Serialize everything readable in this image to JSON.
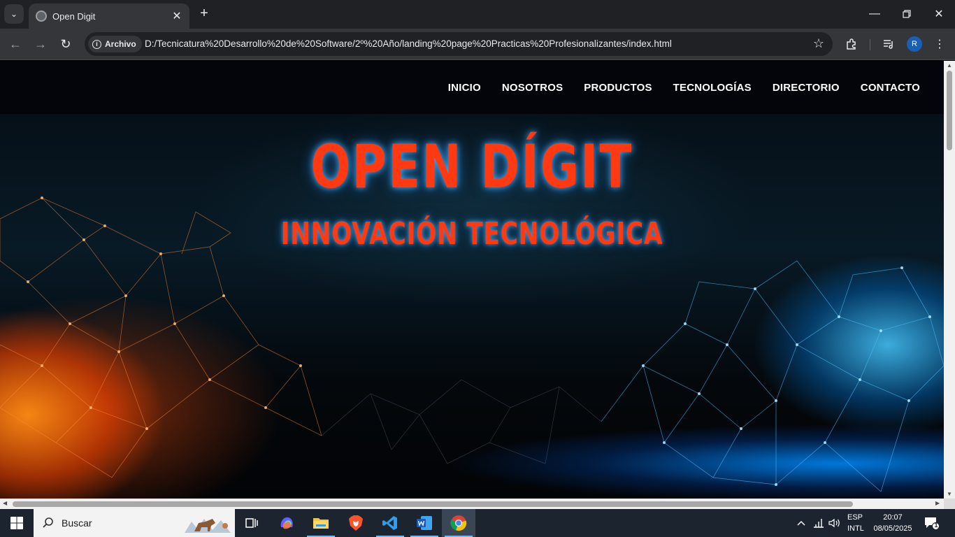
{
  "browser": {
    "tab_title": "Open Digit",
    "address_chip": "Archivo",
    "url": "D:/Tecnicatura%20Desarrollo%20de%20Software/2º%20Año/landing%20page%20Practicas%20Profesionalizantes/index.html",
    "profile_initial": "R"
  },
  "site": {
    "nav": [
      "INICIO",
      "NOSOTROS",
      "PRODUCTOS",
      "TECNOLOGÍAS",
      "DIRECTORIO",
      "CONTACTO"
    ],
    "hero_title": "OPEN DÍGIT",
    "hero_subtitle": "INNOVACIÓN TECNOLÓGICA",
    "accent_color": "#ff3a12",
    "glow_color": "#46b4ff"
  },
  "taskbar": {
    "search_label": "Buscar",
    "apps": [
      "task-view",
      "copilot",
      "file-explorer",
      "brave",
      "vscode",
      "word",
      "chrome"
    ],
    "lang_top": "ESP",
    "lang_bottom": "INTL",
    "time": "20:07",
    "date": "08/05/2025",
    "notification_count": "1"
  }
}
